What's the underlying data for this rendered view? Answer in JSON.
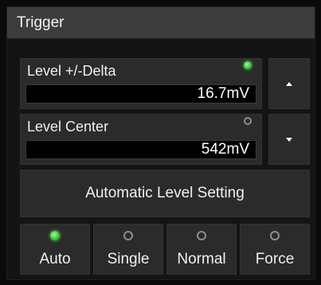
{
  "panel": {
    "title": "Trigger"
  },
  "fields": [
    {
      "label": "Level +/-Delta",
      "value": "16.7mV",
      "indicator_on": true
    },
    {
      "label": "Level Center",
      "value": "542mV",
      "indicator_on": false
    }
  ],
  "side_buttons": {
    "up_icon": "arrow-up-icon",
    "down_icon": "arrow-down-icon"
  },
  "auto_level": {
    "label": "Automatic Level Setting"
  },
  "modes": [
    {
      "label": "Auto",
      "selected": true
    },
    {
      "label": "Single",
      "selected": false
    },
    {
      "label": "Normal",
      "selected": false
    },
    {
      "label": "Force",
      "selected": false
    }
  ],
  "colors": {
    "indicator_on": "#35c23a",
    "indicator_off": "#8e8e8e",
    "header_bg": "#3c3c3c",
    "button_bg": "#2b2b2b"
  }
}
